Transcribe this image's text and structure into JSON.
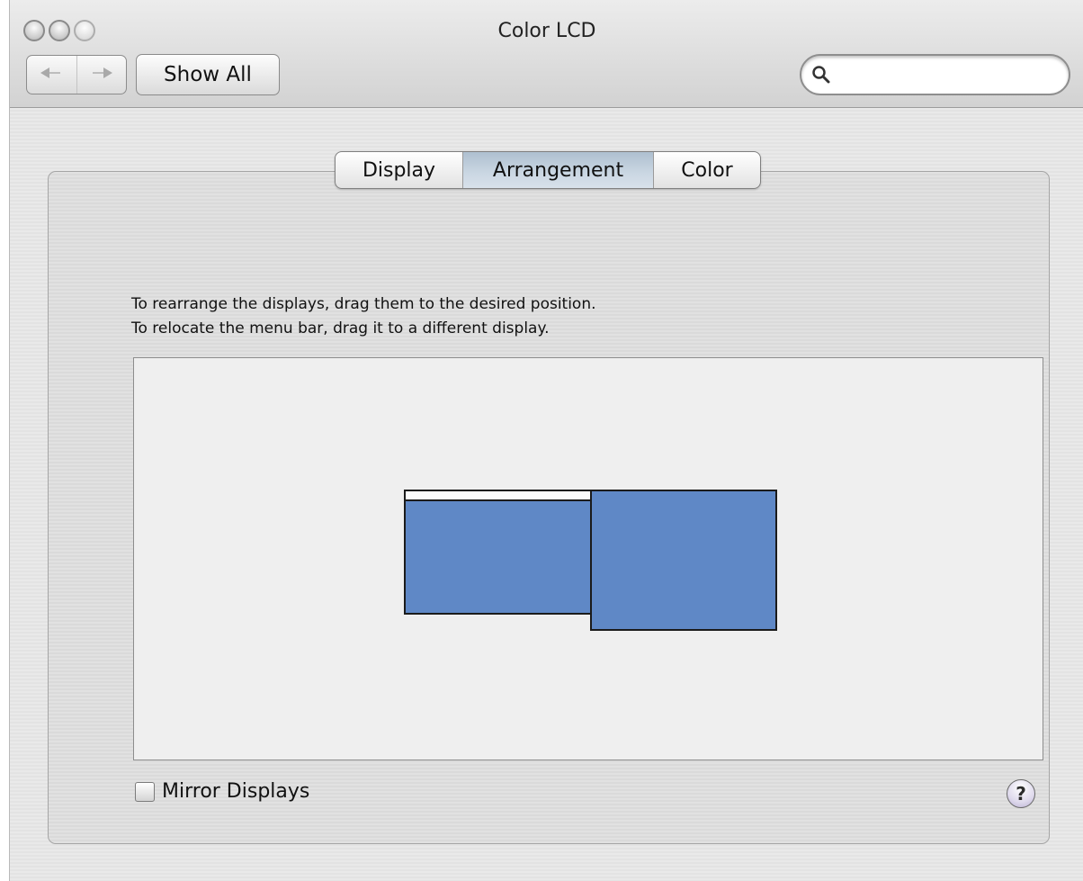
{
  "window": {
    "title": "Color LCD"
  },
  "toolbar": {
    "back_icon": "back-arrow-icon",
    "forward_icon": "forward-arrow-icon",
    "show_all_label": "Show All",
    "search_icon": "magnifying-glass-icon",
    "search_value": ""
  },
  "tabs": [
    {
      "label": "Display",
      "selected": false
    },
    {
      "label": "Arrangement",
      "selected": true
    },
    {
      "label": "Color",
      "selected": false
    }
  ],
  "instructions": {
    "line1": "To rearrange the displays, drag them to the desired position.",
    "line2": "To relocate the menu bar, drag it to a different display."
  },
  "arrangement": {
    "display_color": "#5f88c6",
    "menu_bar_on": "primary-display"
  },
  "mirror_displays": {
    "label": "Mirror Displays",
    "checked": false
  },
  "help": {
    "label": "?",
    "icon": "help-icon"
  }
}
